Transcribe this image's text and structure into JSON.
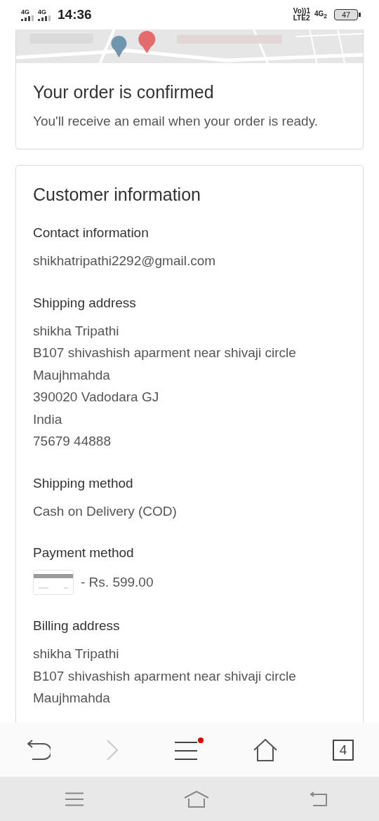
{
  "status_bar": {
    "signal_labels": [
      "4G",
      "4G"
    ],
    "time": "14:36",
    "volte": [
      "Vo))1",
      "LTE2"
    ],
    "network": "4G$_{2}$",
    "battery": "47"
  },
  "confirmation": {
    "title": "Your order is confirmed",
    "message": "You'll receive an email when your order is ready."
  },
  "customer_information": {
    "title": "Customer information",
    "sections": [
      {
        "kind": "lines",
        "heading": "Contact information",
        "lines": [
          "shikhatripathi2292@gmail.com"
        ]
      },
      {
        "kind": "lines",
        "heading": "Shipping address",
        "lines": [
          "shikha Tripathi",
          "B107 shivashish aparment near shivaji circle",
          "Maujhmahda",
          "390020 Vadodara GJ",
          "India",
          "75679 44888"
        ]
      },
      {
        "kind": "lines",
        "heading": "Shipping method",
        "lines": [
          "Cash on Delivery (COD)"
        ]
      },
      {
        "kind": "payment",
        "heading": "Payment method",
        "amount": "- Rs. 599.00"
      },
      {
        "kind": "lines",
        "heading": "Billing address",
        "lines": [
          "shikha Tripathi",
          "B107 shivashish aparment near shivaji circle",
          "Maujhmahda"
        ]
      }
    ]
  },
  "browser_toolbar": {
    "forward_disabled": true,
    "menu_badge": true,
    "tab_count": "4"
  }
}
